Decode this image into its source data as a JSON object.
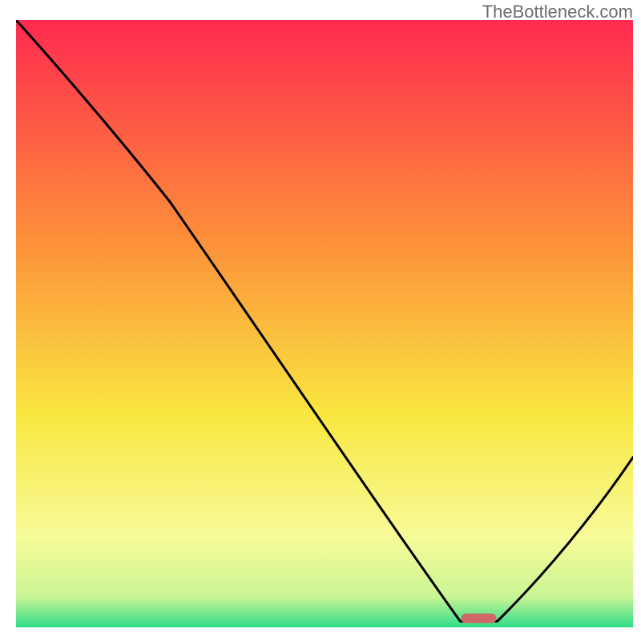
{
  "watermark": "TheBottleneck.com",
  "chart_data": {
    "type": "line",
    "title": "",
    "xlabel": "",
    "ylabel": "",
    "xlim": [
      0,
      100
    ],
    "ylim": [
      0,
      100
    ],
    "gradient_stops": [
      {
        "offset": 0,
        "color": "#ff2a50"
      },
      {
        "offset": 35,
        "color": "#fd8c3a"
      },
      {
        "offset": 65,
        "color": "#f9e740"
      },
      {
        "offset": 85,
        "color": "#f8fb99"
      },
      {
        "offset": 95,
        "color": "#c9f594"
      },
      {
        "offset": 100,
        "color": "#2fdd8a"
      }
    ],
    "series": [
      {
        "name": "curve",
        "color": "#000000",
        "points": [
          {
            "x": 0,
            "y": 100
          },
          {
            "x": 25,
            "y": 70
          },
          {
            "x": 72,
            "y": 1
          },
          {
            "x": 78,
            "y": 1
          },
          {
            "x": 100,
            "y": 28
          }
        ]
      }
    ],
    "marker": {
      "x": 75,
      "y": 1.5,
      "color": "#d06868",
      "rx": 22,
      "ry": 5
    }
  }
}
